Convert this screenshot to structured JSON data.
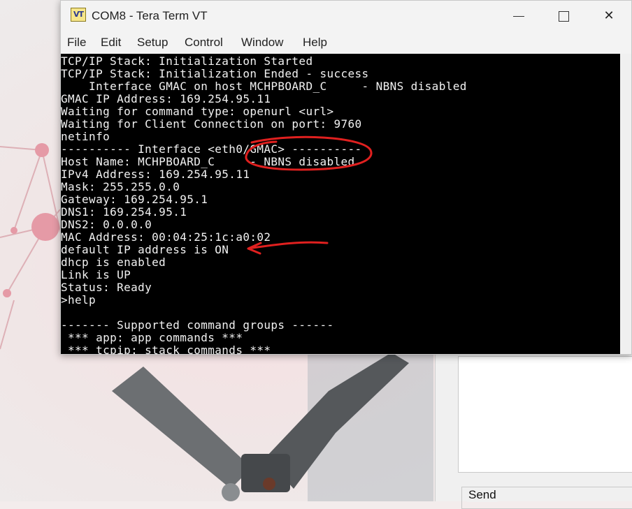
{
  "window": {
    "title": "COM8 - Tera Term VT",
    "icon": "VT",
    "controls": {
      "minimize": "minimize-icon",
      "maximize": "maximize-icon",
      "close": "✕"
    }
  },
  "menu": [
    "File",
    "Edit",
    "Setup",
    "Control",
    "Window",
    "Help"
  ],
  "terminal": {
    "lines": [
      "TCP/IP Stack: Initialization Started",
      "TCP/IP Stack: Initialization Ended - success",
      "    Interface GMAC on host MCHPBOARD_C     - NBNS disabled",
      "GMAC IP Address: 169.254.95.11",
      "Waiting for command type: openurl <url>",
      "Waiting for Client Connection on port: 9760",
      "netinfo",
      "---------- Interface <eth0/GMAC> ----------",
      "Host Name: MCHPBOARD_C     - NBNS disabled",
      "IPv4 Address: 169.254.95.11",
      "Mask: 255.255.0.0",
      "Gateway: 169.254.95.1",
      "DNS1: 169.254.95.1",
      "DNS2: 0.0.0.0",
      "MAC Address: 00:04:25:1c:a0:02",
      "default IP address is ON",
      "dhcp is enabled",
      "Link is UP",
      "Status: Ready",
      ">help",
      "",
      "------- Supported command groups ------",
      " *** app: app commands ***",
      " *** tcpip: stack commands ***"
    ]
  },
  "background": {
    "send_label": "Send"
  },
  "colors": {
    "terminal_bg": "#000000",
    "terminal_fg": "#f2f2f2",
    "annotation": "#e0201f"
  }
}
